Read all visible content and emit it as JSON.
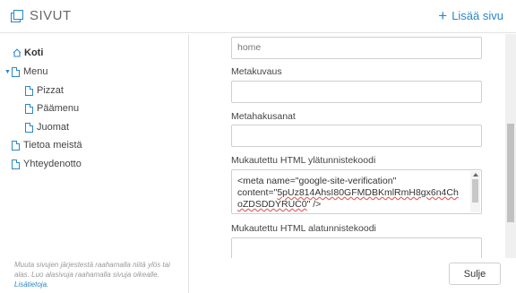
{
  "header": {
    "title": "SIVUT",
    "add_label": "Lisää sivu"
  },
  "sidebar": {
    "items": [
      {
        "label": "Koti"
      },
      {
        "label": "Menu"
      },
      {
        "label": "Pizzat"
      },
      {
        "label": "Päämenu"
      },
      {
        "label": "Juomat"
      },
      {
        "label": "Tietoa meistä"
      },
      {
        "label": "Yhteydenotto"
      }
    ],
    "footer_text": "Muuta sivujen järjestestä raahamalla niitä ylös tai alas. Luo alasivuja raahamalla sivuja oikealle.",
    "footer_link": "Lisätietoja."
  },
  "form": {
    "url_value": "home",
    "meta_description_label": "Metakuvaus",
    "meta_description_value": "",
    "meta_keywords_label": "Metahakusanat",
    "meta_keywords_value": "",
    "header_code_label": "Mukautettu HTML ylätunnistekoodi",
    "header_code_line1": "<meta name=\"google-site-verification\"",
    "header_code_line2_pre": "content=\"",
    "header_code_line2_squiggle": "5pUz814AhsI80GFMDBKmlRmH8gx6n4Ch",
    "header_code_line3_squiggle": "oZDSDDYRUC0",
    "header_code_line3_post": "\" />",
    "footer_code_label": "Mukautettu HTML alatunnistekoodi",
    "footer_code_value": ""
  },
  "footer": {
    "close_label": "Sulje"
  }
}
